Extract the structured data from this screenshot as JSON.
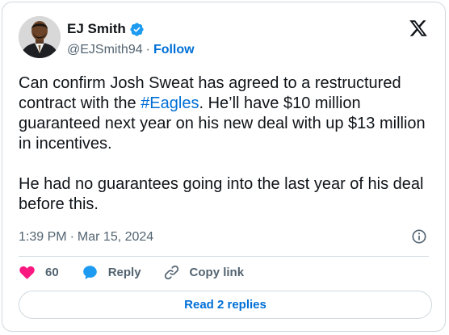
{
  "author": {
    "display_name": "EJ Smith",
    "handle": "@EJSmith94",
    "separator": "·",
    "follow_label": "Follow",
    "verified": true,
    "avatar_icon": "user-avatar-photo"
  },
  "tweet": {
    "text_part1": "Can confirm Josh Sweat has agreed to a restructured contract with the ",
    "hashtag": "#Eagles",
    "text_part2": ". He’ll have $10 million guaranteed next year on his new deal with up $13 million in incentives.",
    "paragraph2": "He had no guarantees going into the last year of his deal before this."
  },
  "meta": {
    "time": "1:39 PM",
    "separator": "·",
    "date": "Mar 15, 2024"
  },
  "actions": {
    "like_count": "60",
    "reply_label": "Reply",
    "copy_link_label": "Copy link"
  },
  "read_replies_label": "Read 2 replies",
  "colors": {
    "link_blue": "#006fd6",
    "heart_red": "#f91880",
    "reply_blue": "#1d9bf0",
    "verified_blue": "#1d9bf0",
    "muted_text": "#536471",
    "border": "#cfd9de"
  },
  "icons": [
    "verified-badge-icon",
    "x-logo-icon",
    "info-icon",
    "heart-icon",
    "reply-bubble-icon",
    "link-icon"
  ]
}
